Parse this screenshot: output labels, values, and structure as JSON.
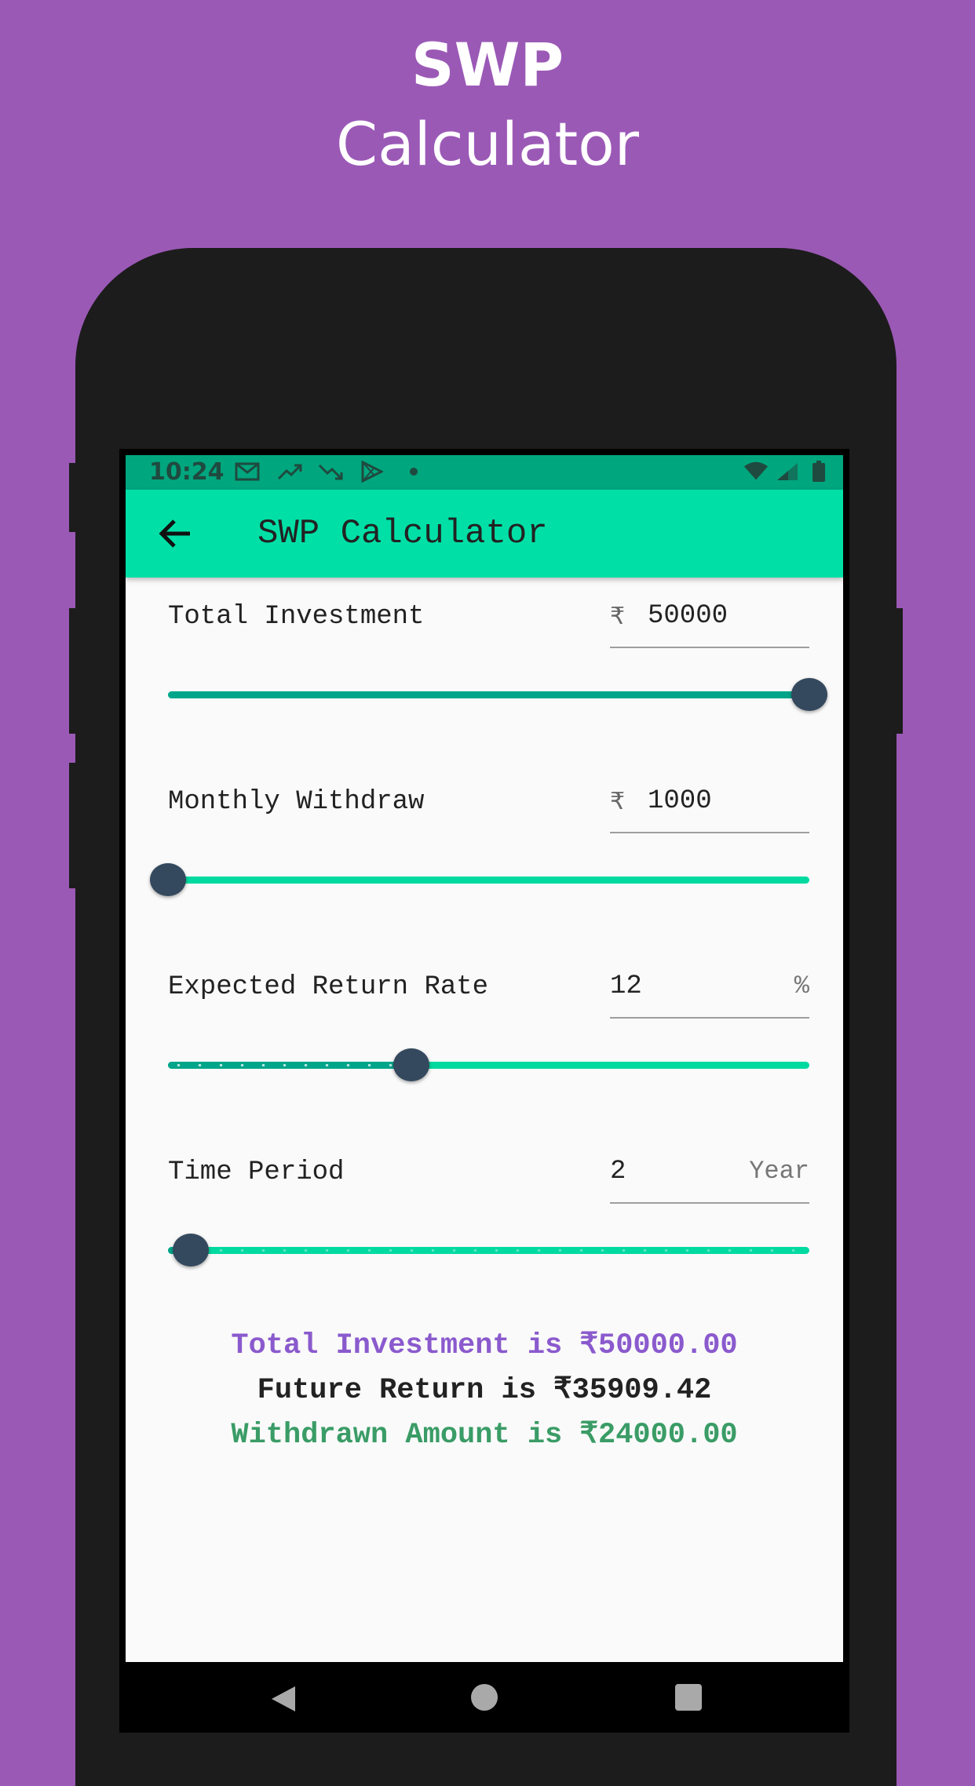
{
  "promo": {
    "title": "SWP",
    "subtitle": "Calculator"
  },
  "status_bar": {
    "time": "10:24",
    "icons": [
      "gmail-icon",
      "trending-up-icon",
      "trending-down-icon",
      "play-store-icon",
      "dot-icon",
      "wifi-icon",
      "signal-icon",
      "battery-icon"
    ]
  },
  "app_bar": {
    "title": "SWP Calculator",
    "back_icon": "arrow-left-icon"
  },
  "inputs": [
    {
      "label": "Total Investment",
      "prefix": "₹",
      "value": "50000",
      "suffix": "",
      "slider_fraction": 1.0
    },
    {
      "label": "Monthly Withdraw",
      "prefix": "₹",
      "value": "1000",
      "suffix": "",
      "slider_fraction": 0.0
    },
    {
      "label": "Expected Return Rate",
      "prefix": "",
      "value": "12",
      "suffix": "%",
      "slider_fraction": 0.38
    },
    {
      "label": "Time Period",
      "prefix": "",
      "value": "2",
      "suffix": "Year",
      "slider_fraction": 0.035
    }
  ],
  "results": {
    "total_investment": "Total Investment is ₹50000.00",
    "future_return": "Future Return is ₹35909.42",
    "withdrawn_amount": "Withdrawn Amount is ₹24000.00"
  },
  "colors": {
    "promo_background": "#9b59b6",
    "status_bar": "#00a67e",
    "app_bar": "#00e0a6",
    "slider_active": "#00a58a",
    "slider_inactive": "#00d9a0",
    "slider_thumb": "#34495e",
    "total_investment_text": "#8a5acd",
    "future_return_text": "#222222",
    "withdrawn_amount_text": "#3a9c66"
  },
  "nav_bar": {
    "icons": [
      "back-triangle-icon",
      "home-circle-icon",
      "recents-square-icon"
    ]
  }
}
